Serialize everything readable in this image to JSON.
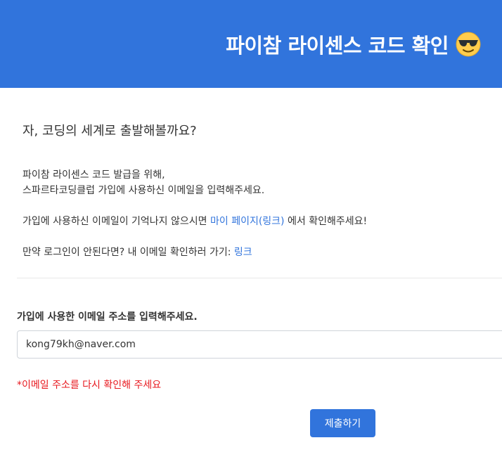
{
  "header": {
    "title": "파이참 라이센스 코드 확인",
    "background_color": "#3174dc"
  },
  "intro": {
    "heading": "자, 코딩의 세계로 출발해볼까요?",
    "line1": "파이참 라이센스 코드 발급을 위해,",
    "line2": "스파르타코딩클럽 가입에 사용하신 이메일을 입력해주세요.",
    "forgot_prefix": "가입에 사용하신 이메일이 기억나지 않으시면 ",
    "forgot_link": "마이 페이지(링크)",
    "forgot_suffix": " 에서 확인해주세요!",
    "login_prefix": "만약 로그인이 안된다면? 내 이메일 확인하러 가기: ",
    "login_link": "링크"
  },
  "form": {
    "label": "가입에 사용한 이메일 주소를 입력해주세요.",
    "email_value": "kong79kh@naver.com",
    "error": "*이메일 주소를 다시 확인해 주세요",
    "submit_label": "제출하기"
  },
  "colors": {
    "accent": "#3174dc",
    "error": "#e8191f"
  }
}
